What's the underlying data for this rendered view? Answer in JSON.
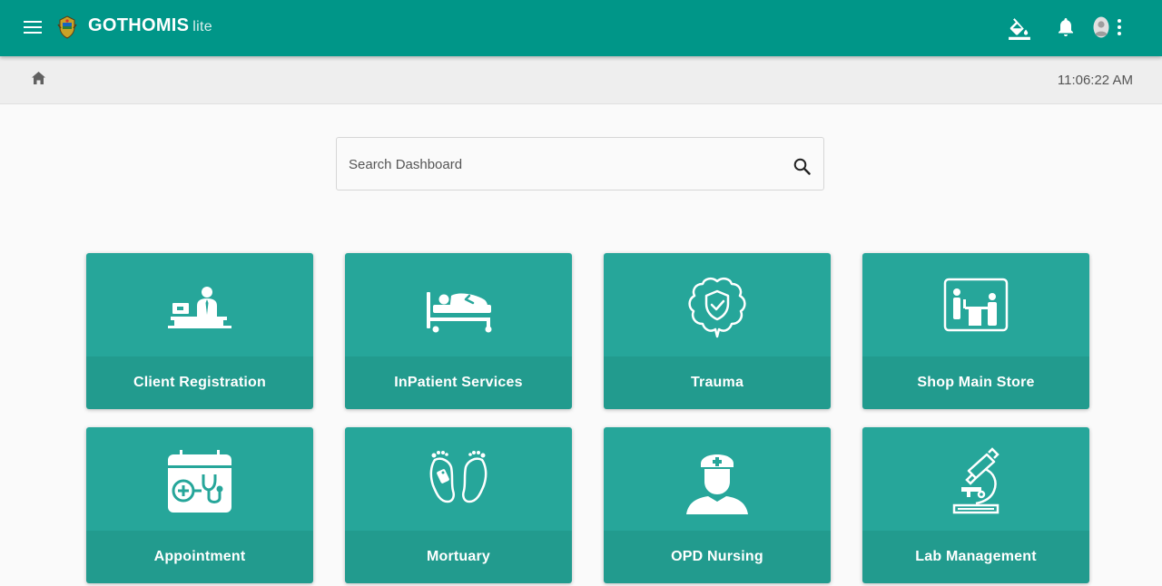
{
  "header": {
    "app_name": "GOTHOMIS",
    "app_suffix": "lite",
    "icons": [
      "menu-icon",
      "coat-of-arms-logo",
      "format-color-fill-icon",
      "bell-icon",
      "avatar-icon",
      "more-vert-icon"
    ]
  },
  "breadcrumb": {
    "icon": "home-icon",
    "time": "11:06:22 AM"
  },
  "search": {
    "placeholder": "Search Dashboard",
    "value": "",
    "icon": "search-icon"
  },
  "tiles": [
    {
      "label": "Client Registration",
      "icon": "reception-desk-icon"
    },
    {
      "label": "InPatient Services",
      "icon": "patient-bed-icon"
    },
    {
      "label": "Trauma",
      "icon": "brain-shield-icon"
    },
    {
      "label": "Shop Main Store",
      "icon": "shop-counter-icon"
    },
    {
      "label": "Appointment",
      "icon": "calendar-stethoscope-icon"
    },
    {
      "label": "Mortuary",
      "icon": "feet-tag-icon"
    },
    {
      "label": "OPD Nursing",
      "icon": "nurse-icon"
    },
    {
      "label": "Lab Management",
      "icon": "microscope-icon"
    }
  ],
  "colors": {
    "primary": "#009688",
    "tile": "#26a69a",
    "tile_footer": "#229b8e",
    "page_bg": "#fafafa"
  }
}
